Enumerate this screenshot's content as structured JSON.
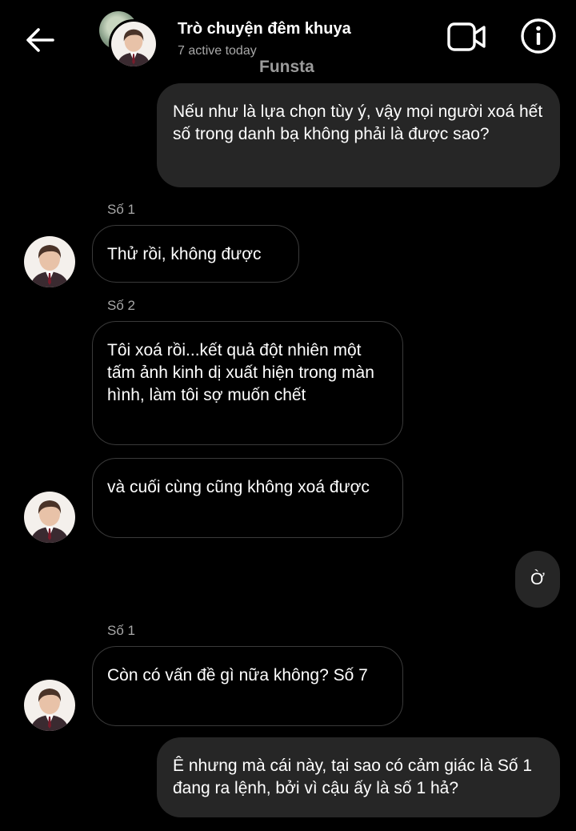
{
  "header": {
    "title": "Trò chuyện đêm khuya",
    "status": "7 active today",
    "watermark": "Funsta"
  },
  "messages": [
    {
      "direction": "outgoing",
      "text": "Nếu như là lựa chọn tùy ý, vậy mọi người xoá hết số trong danh bạ không phải là được sao?"
    },
    {
      "direction": "incoming",
      "sender": "Số 1",
      "text": "Thử rồi, không được"
    },
    {
      "direction": "incoming",
      "sender": "Số 2",
      "text": "Tôi xoá rồi...kết quả đột nhiên một tấm ảnh kinh dị xuất hiện trong màn hình, làm tôi sợ muốn chết"
    },
    {
      "direction": "incoming",
      "text": "và cuối cùng cũng không xoá được"
    },
    {
      "direction": "outgoing",
      "text": "Ờ"
    },
    {
      "direction": "incoming",
      "sender": "Số 1",
      "text": "Còn có vấn đề gì nữa không? Số 7"
    },
    {
      "direction": "outgoing",
      "text": "Ê nhưng mà cái này, tại sao có cảm giác là Số 1 đang ra lệnh, bởi vì cậu ấy là số 1 hả?"
    }
  ],
  "colors": {
    "background": "#000000",
    "outgoing_bubble": "#262626",
    "incoming_border": "#3a3a3a",
    "secondary_text": "#a8a8a8"
  },
  "icons": {
    "back": "arrow-left-icon",
    "video": "video-camera-icon",
    "info": "info-circle-icon"
  }
}
